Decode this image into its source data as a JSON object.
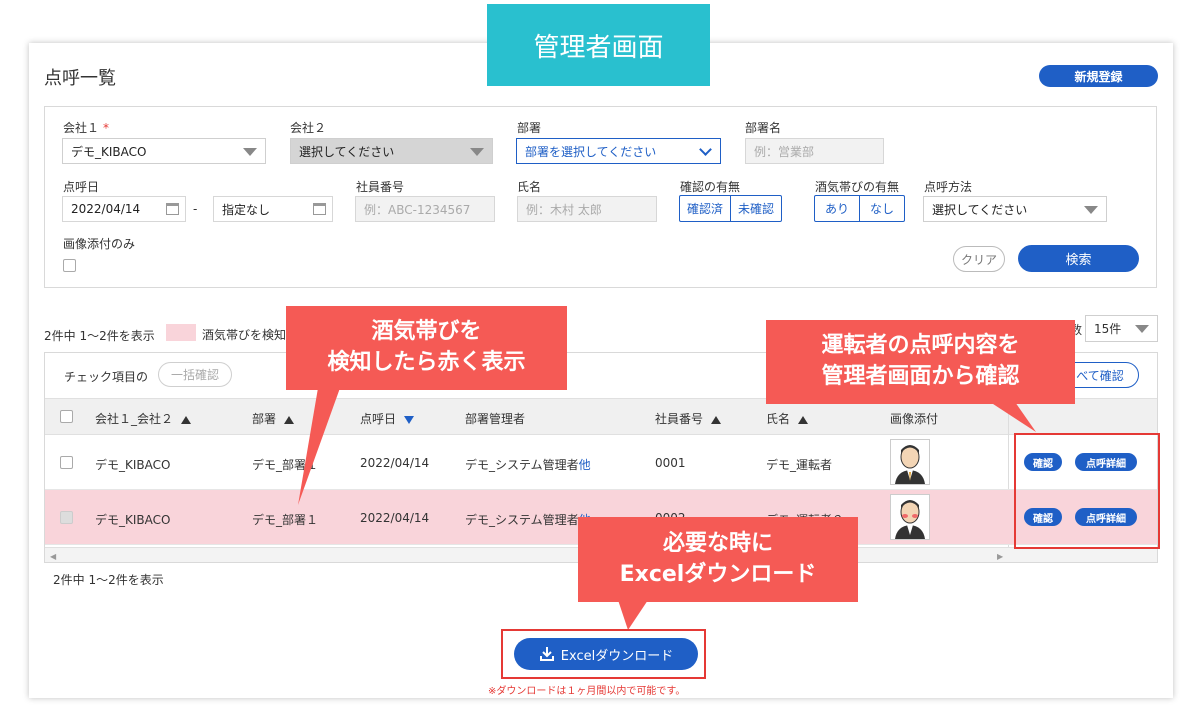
{
  "banner": "管理者画面",
  "header": {
    "title": "点呼一覧",
    "new_button": "新規登録"
  },
  "search": {
    "company1_label": "会社１",
    "company1_required": "*",
    "company1_value": "デモ_KIBACO",
    "company2_label": "会社２",
    "company2_value": "選択してください",
    "dept_label": "部署",
    "dept_value": "部署を選択してください",
    "dept_name_label": "部署名",
    "dept_name_placeholder": "例：営業部",
    "date_label": "点呼日",
    "date_from": "2022/04/14",
    "date_sep": "-",
    "date_to": "指定なし",
    "emp_no_label": "社員番号",
    "emp_no_placeholder": "例：ABC-1234567",
    "name_label": "氏名",
    "name_placeholder": "例：木村 太郎",
    "confirmed_label": "確認の有無",
    "confirmed_opts": [
      "確認済",
      "未確認"
    ],
    "alcohol_label": "酒気帯びの有無",
    "alcohol_opts": [
      "あり",
      "なし"
    ],
    "method_label": "点呼方法",
    "method_value": "選択してください",
    "image_only_label": "画像添付のみ",
    "clear_button": "クリア",
    "search_button": "検索"
  },
  "list": {
    "count_text": "2件中 1〜2件を表示",
    "legend_text": "酒気帯びを検知",
    "perpage_label": "数",
    "perpage_value": "15件",
    "bulk_label": "チェック項目の",
    "bulk_button": "一括確認",
    "all_confirm_button": "べて確認",
    "columns": [
      "会社１_会社２",
      "部署",
      "点呼日",
      "部署管理者",
      "社員番号",
      "氏名",
      "画像添付"
    ],
    "rows": [
      {
        "company": "デモ_KIBACO",
        "dept": "デモ_部署１",
        "date": "2022/04/14",
        "manager": "デモ_システム管理者",
        "other": "他",
        "emp_no": "0001",
        "name": "デモ_運転者",
        "alert": false
      },
      {
        "company": "デモ_KIBACO",
        "dept": "デモ_部署１",
        "date": "2022/04/14",
        "manager": "デモ_システム管理者",
        "other": "他",
        "emp_no": "0002",
        "name": "デモ_運転者２",
        "alert": true
      }
    ],
    "confirm_button": "確認",
    "detail_button": "点呼詳細",
    "count_bottom": "2件中 1〜2件を表示"
  },
  "excel": {
    "button": "Excelダウンロード",
    "note": "※ダウンロードは１ヶ月間以内で可能です。"
  },
  "callouts": {
    "alcohol": [
      "酒気帯びを",
      "検知したら赤く表示"
    ],
    "confirm": [
      "運転者の点呼内容を",
      "管理者画面から確認"
    ],
    "excel": [
      "必要な時に",
      "Excelダウンロード"
    ]
  },
  "colors": {
    "accent": "#1f5fc6",
    "banner": "#29c0cf",
    "callout": "#f55a55",
    "alert_row": "#f9d4da"
  }
}
